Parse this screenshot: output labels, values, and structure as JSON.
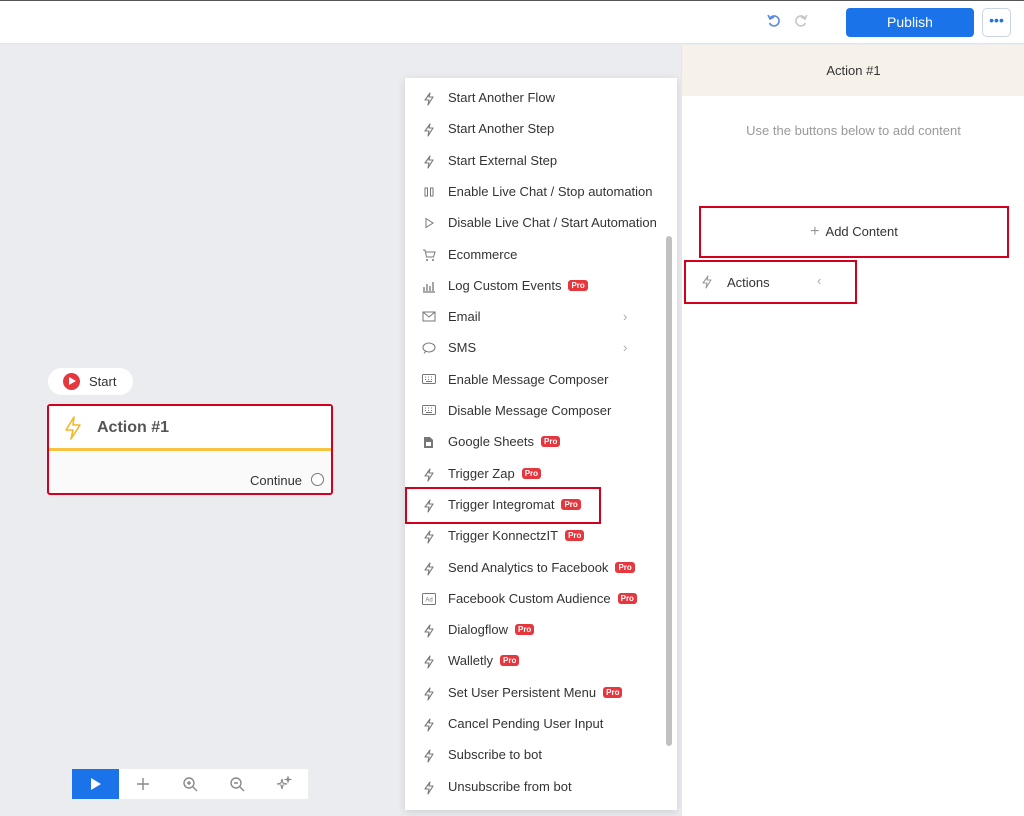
{
  "header": {
    "undo_icon": "undo-icon",
    "redo_icon": "redo-icon",
    "publish_label": "Publish",
    "more_label": "•••"
  },
  "canvas": {
    "start_label": "Start",
    "node": {
      "title": "Action #1",
      "continue_label": "Continue"
    }
  },
  "menu": {
    "items": [
      {
        "label": "Start Another Flow",
        "icon": "bolt-icon"
      },
      {
        "label": "Start Another Step",
        "icon": "bolt-icon"
      },
      {
        "label": "Start External Step",
        "icon": "bolt-icon"
      },
      {
        "label": "Enable Live Chat / Stop automation",
        "icon": "pause-icon"
      },
      {
        "label": "Disable Live Chat / Start Automation",
        "icon": "play-icon"
      },
      {
        "label": "Ecommerce",
        "icon": "cart-icon"
      },
      {
        "label": "Log Custom Events",
        "icon": "chart-icon",
        "badge": "Pro"
      },
      {
        "label": "Email",
        "icon": "mail-icon",
        "chevron": true
      },
      {
        "label": "SMS",
        "icon": "sms-icon",
        "chevron": true
      },
      {
        "label": "Enable Message Composer",
        "icon": "keyboard-icon"
      },
      {
        "label": "Disable Message Composer",
        "icon": "keyboard-icon"
      },
      {
        "label": "Google Sheets",
        "icon": "sheet-icon",
        "badge": "Pro"
      },
      {
        "label": "Trigger Zap",
        "icon": "bolt-icon",
        "badge": "Pro"
      },
      {
        "label": "Trigger Integromat",
        "icon": "bolt-icon",
        "badge": "Pro"
      },
      {
        "label": "Trigger KonnectzIT",
        "icon": "bolt-icon",
        "badge": "Pro"
      },
      {
        "label": "Send Analytics to Facebook",
        "icon": "bolt-icon",
        "badge": "Pro"
      },
      {
        "label": "Facebook Custom Audience",
        "icon": "ad-icon",
        "badge": "Pro"
      },
      {
        "label": "Dialogflow",
        "icon": "bolt-icon",
        "badge": "Pro"
      },
      {
        "label": "Walletly",
        "icon": "bolt-icon",
        "badge": "Pro"
      },
      {
        "label": "Set User Persistent Menu",
        "icon": "bolt-icon",
        "badge": "Pro"
      },
      {
        "label": "Cancel Pending User Input",
        "icon": "bolt-icon"
      },
      {
        "label": "Subscribe to bot",
        "icon": "bolt-icon"
      },
      {
        "label": "Unsubscribe from bot",
        "icon": "bolt-icon"
      }
    ]
  },
  "panel": {
    "title": "Action #1",
    "hint": "Use the buttons below to add content",
    "add_content_label": "Add Content",
    "actions_label": "Actions"
  },
  "colors": {
    "accent": "#1a73e8",
    "highlight": "#d2001c",
    "pro_badge": "#e5373d",
    "node_underline": "#f8c341"
  }
}
